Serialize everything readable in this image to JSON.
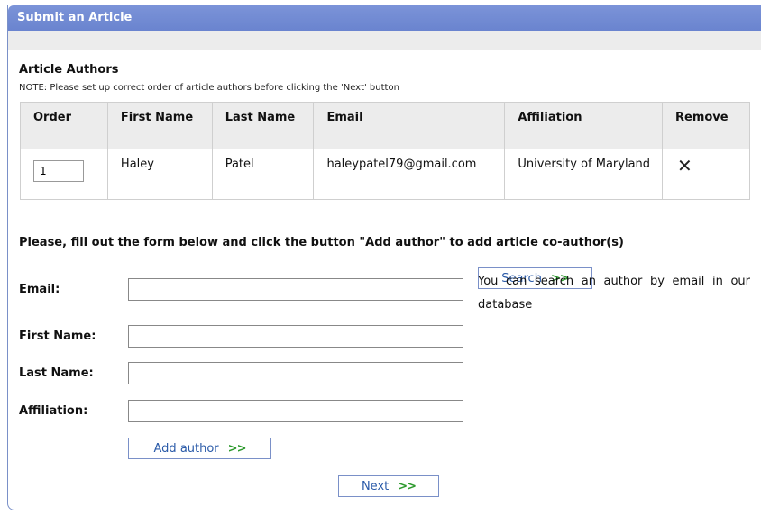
{
  "panel": {
    "title": "Submit an Article"
  },
  "authors_section": {
    "title": "Article Authors",
    "note": "NOTE: Please set up correct order of article authors before clicking the 'Next' button",
    "columns": [
      "Order",
      "First Name",
      "Last Name",
      "Email",
      "Affiliation",
      "Remove"
    ],
    "rows": [
      {
        "order": "1",
        "first_name": "Haley",
        "last_name": "Patel",
        "email": "haleypatel79@gmail.com",
        "affiliation": "University of Maryland",
        "remove_icon": "close-x-icon"
      }
    ]
  },
  "form": {
    "instructions": "Please, fill out the form below and click the button \"Add author\" to add article co-author(s)",
    "email_label": "Email:",
    "first_name_label": "First Name:",
    "last_name_label": "Last Name:",
    "affiliation_label": "Affiliation:",
    "email_value": "",
    "first_name_value": "",
    "last_name_value": "",
    "affiliation_value": "",
    "search_label": "Search",
    "search_hint": "You can search an author by email in our database",
    "add_author_label": "Add author",
    "next_label": "Next",
    "chevron_glyph": ">>"
  },
  "colors": {
    "header": "#6f88d2",
    "button_border": "#7a90c8",
    "button_text": "#2a5aa8",
    "chevron": "#2e9a2e"
  }
}
